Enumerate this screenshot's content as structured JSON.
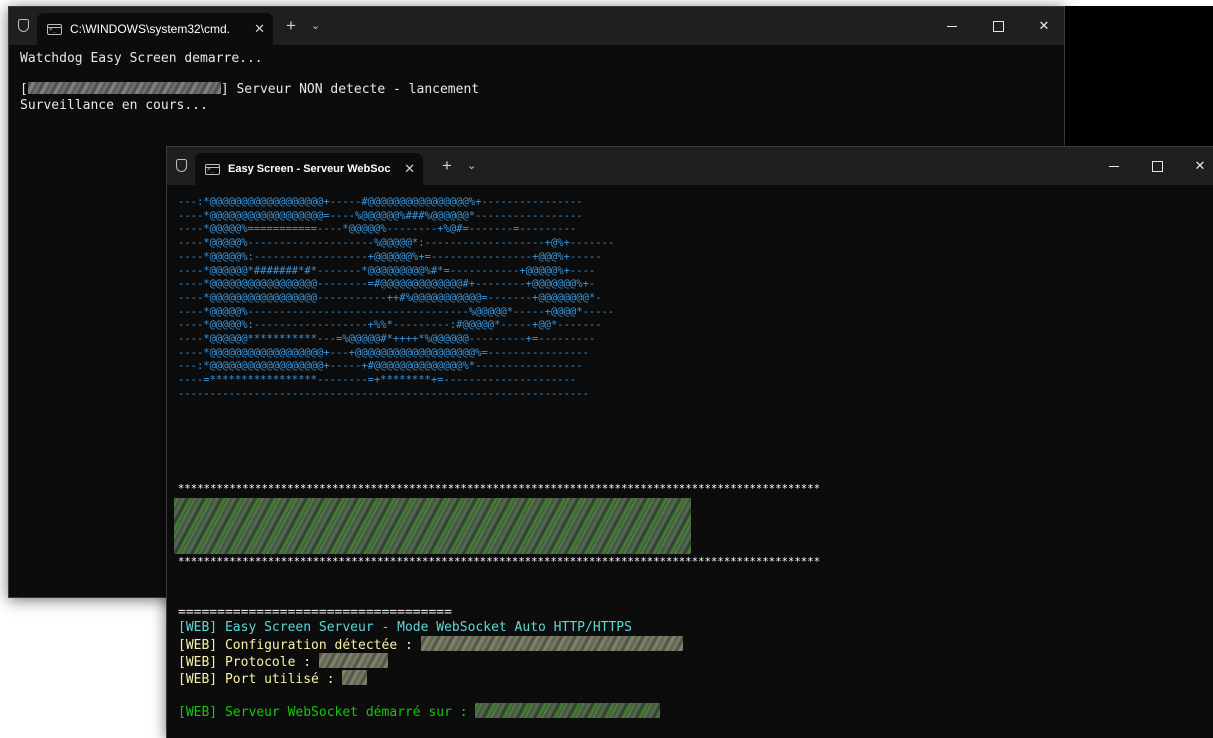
{
  "window1": {
    "tab_title": "C:\\WINDOWS\\system32\\cmd.",
    "lines": {
      "line1": "Watchdog Easy Screen demarre...",
      "line2_prefix": "[",
      "line2_suffix": "] Serveur NON detecte - lancement",
      "line3": "Surveillance en cours..."
    }
  },
  "window2": {
    "tab_title": "Easy Screen - Serveur WebSoc",
    "ascii_art": [
      "---:*@@@@@@@@@@@@@@@@@@+-----#@@@@@@@@@@@@@@@@%+----------------",
      "----*@@@@@@@@@@@@@@@@@@=----%@@@@@@%###%@@@@@@*-----------------",
      "----*@@@@@%===========----*@@@@@%--------+%@#=-------=---------",
      "----*@@@@@%--------------------%@@@@@*:-------------------+@%+-------",
      "----*@@@@@%:------------------+@@@@@@%+=----------------+@@@%+-----",
      "----*@@@@@@*#######*#*-------*@@@@@@@@@%#*=-----------+@@@@@%+----",
      "----*@@@@@@@@@@@@@@@@@--------=#@@@@@@@@@@@@@#+--------+@@@@@@@%+-",
      "----*@@@@@@@@@@@@@@@@@-----------++#%@@@@@@@@@@@=-------+@@@@@@@@*-",
      "----*@@@@@%-----------------------------------%@@@@@*-----+@@@@*-----",
      "----*@@@@@%:------------------+%%*---------:#@@@@@*-----+@@*-------",
      "----*@@@@@@***********---=%@@@@@#*++++*%@@@@@@---------+=---------",
      "----*@@@@@@@@@@@@@@@@@@+---+@@@@@@@@@@@@@@@@@@@%=----------------",
      "---:*@@@@@@@@@@@@@@@@@@+-----+#@@@@@@@@@@@@@@%*-----------------",
      "----=*****************--------=+********+=---------------------",
      "-----------------------------------------------------------------"
    ],
    "stars_top": "****************************************************************************************************",
    "stars_bottom": "****************************************************************************************************",
    "separator": "===================================",
    "web_title": "[WEB] Easy Screen Serveur - Mode WebSocket Auto HTTP/HTTPS",
    "web_config": "[WEB] Configuration détectée : ",
    "web_protocol": "[WEB] Protocole : ",
    "web_port": "[WEB] Port utilisé : ",
    "web_started": "[WEB] Serveur WebSocket démarré sur : "
  },
  "colors": {
    "terminal_bg": "#0c0c0c",
    "titlebar_bg": "#1f1f1f",
    "ascii_blue": "#3a96dd",
    "cyan": "#61d6d6",
    "yellow": "#f9f1a5",
    "green": "#16c60c"
  },
  "icons": {
    "shield": "shield-icon",
    "terminal": "terminal-tab-icon",
    "new_tab": "plus-icon",
    "dropdown": "chevron-down-icon",
    "close": "close-icon",
    "minimize": "minimize-icon",
    "maximize": "maximize-icon"
  },
  "glyphs": {
    "close": "✕",
    "new_tab": "+",
    "dropdown": "⌄"
  }
}
